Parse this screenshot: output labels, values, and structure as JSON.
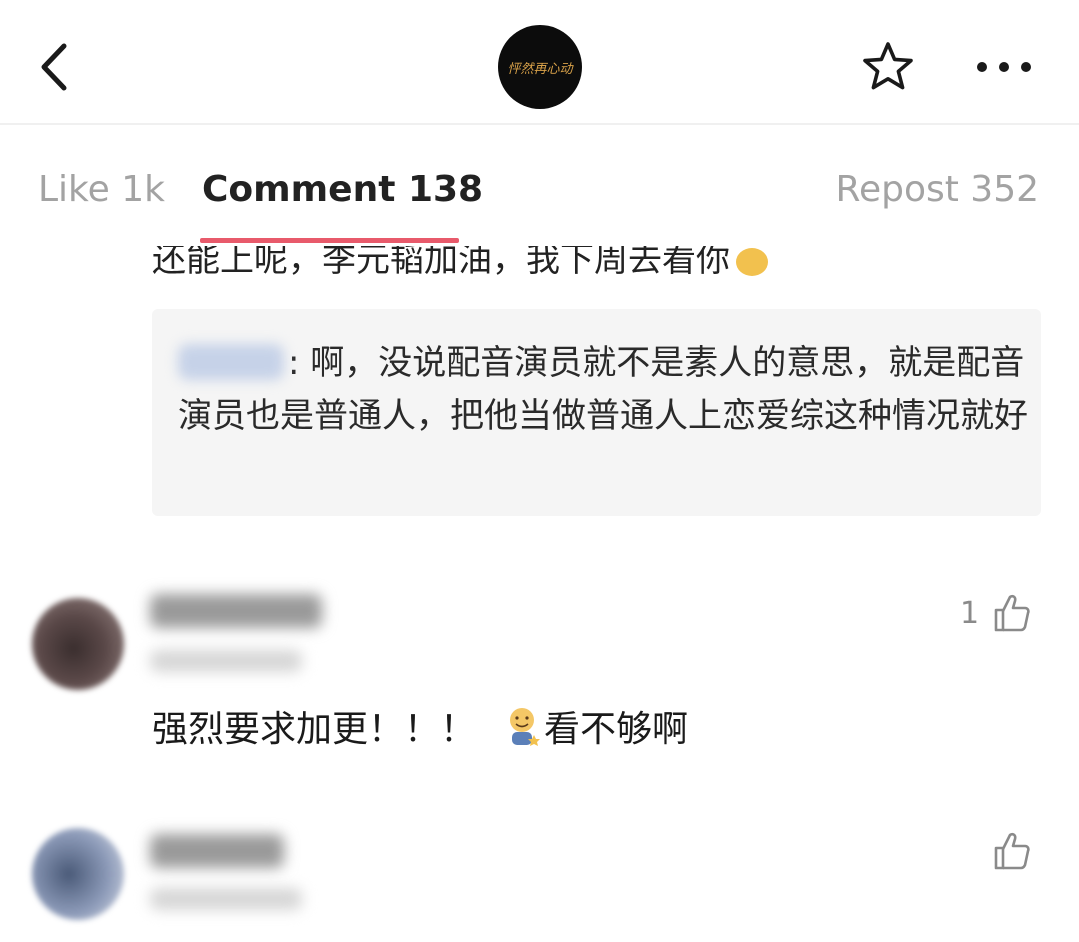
{
  "header": {
    "logo_text": "怦然再心动",
    "back_icon": "chevron-left-icon",
    "favorite_icon": "star-outline-icon",
    "more_icon": "more-dots-icon"
  },
  "tabs": {
    "like_label": "Like 1k",
    "comment_label": "Comment 138",
    "repost_label": "Repost 352",
    "active": "comment",
    "active_color": "#e85a6b"
  },
  "partial_comment": {
    "text": "还能上呢，李元韬加油，我下周去看你"
  },
  "reply": {
    "text": ": 啊，没说配音演员就不是素人的意思，就是配音演员也是普通人，把他当做普通人上恋爱综这种情况就好"
  },
  "comments": [
    {
      "like_count": "1",
      "text_before_emoji": "强烈要求加更！！！",
      "text_after_emoji": "看不够啊",
      "emoji": "smiling-face-emoji"
    },
    {
      "like_count": "",
      "text_before_emoji": "",
      "text_after_emoji": "",
      "emoji": ""
    }
  ]
}
